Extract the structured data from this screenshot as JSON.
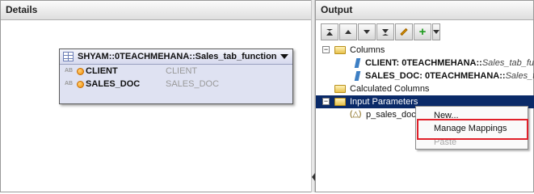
{
  "details_panel": {
    "title": "Details"
  },
  "node": {
    "title": "SHYAM::0TEACHMEHANA::Sales_tab_function",
    "rows": [
      {
        "type_badge": "AB",
        "name": "CLIENT",
        "source": "CLIENT"
      },
      {
        "type_badge": "AB",
        "name": "SALES_DOC",
        "source": "SALES_DOC"
      }
    ]
  },
  "output_panel": {
    "title": "Output"
  },
  "toolbar": {
    "buttons": [
      "move-top-icon",
      "move-up-icon",
      "move-down-icon",
      "move-bottom-icon",
      "edit-icon",
      "add-icon",
      "dropdown-icon"
    ]
  },
  "tree": {
    "columns_label": "Columns",
    "column_items": [
      {
        "bold": "CLIENT: 0TEACHMEHANA::",
        "italic": "Sales_tab_fur"
      },
      {
        "bold": "SALES_DOC: 0TEACHMEHANA::",
        "italic": "Sales_tab"
      }
    ],
    "calculated_label": "Calculated Columns",
    "input_params_label": "Input Parameters",
    "param_items": [
      {
        "label": "p_sales_doc"
      }
    ]
  },
  "context_menu": {
    "items": [
      {
        "label": "New...",
        "enabled": true
      },
      {
        "label": "Manage Mappings",
        "enabled": true
      },
      {
        "label": "Paste",
        "enabled": false
      }
    ]
  },
  "colors": {
    "selection": "#0a2a68",
    "highlight": "#e0202a",
    "node_bg": "#dfe2f2"
  }
}
